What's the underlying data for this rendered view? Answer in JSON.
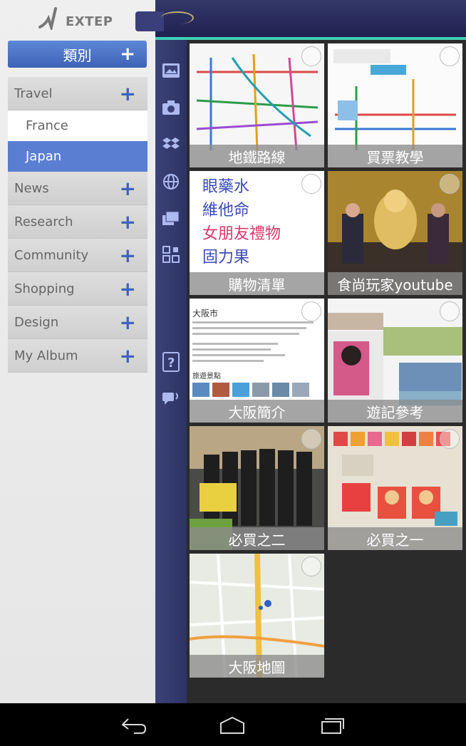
{
  "app": {
    "logo_text": "EXTEP"
  },
  "sidebar": {
    "category_title": "類別",
    "plus_symbol": "+",
    "categories": [
      {
        "label": "Travel",
        "expanded": true,
        "children": [
          "France",
          "Japan"
        ],
        "active_child": "Japan"
      },
      {
        "label": "News"
      },
      {
        "label": "Research"
      },
      {
        "label": "Community"
      },
      {
        "label": "Shopping"
      },
      {
        "label": "Design"
      },
      {
        "label": "My Album"
      }
    ]
  },
  "rail": {
    "icons": [
      "gallery-icon",
      "camera-icon",
      "dropbox-icon",
      "globe-icon",
      "pages-icon",
      "qr-icon",
      "help-icon",
      "chat-icon"
    ]
  },
  "tiles": [
    {
      "caption": "地鐵路線"
    },
    {
      "caption": "買票教學"
    },
    {
      "caption": "購物清單"
    },
    {
      "caption": "食尚玩家youtube"
    },
    {
      "caption": "大阪簡介"
    },
    {
      "caption": "遊記參考"
    },
    {
      "caption": "必買之二"
    },
    {
      "caption": "必買之一"
    },
    {
      "caption": "大阪地圖"
    }
  ],
  "thumb_text": {
    "hand_lines": [
      "眼藥水",
      "維他命",
      "女朋友禮物",
      "固力果"
    ],
    "osaka_title": "大阪市",
    "osaka_sub": "旅遊景點"
  },
  "colors": {
    "accent_blue": "#4a70c6",
    "rail": "#2d3364",
    "teal_line": "#3fd0b8"
  }
}
